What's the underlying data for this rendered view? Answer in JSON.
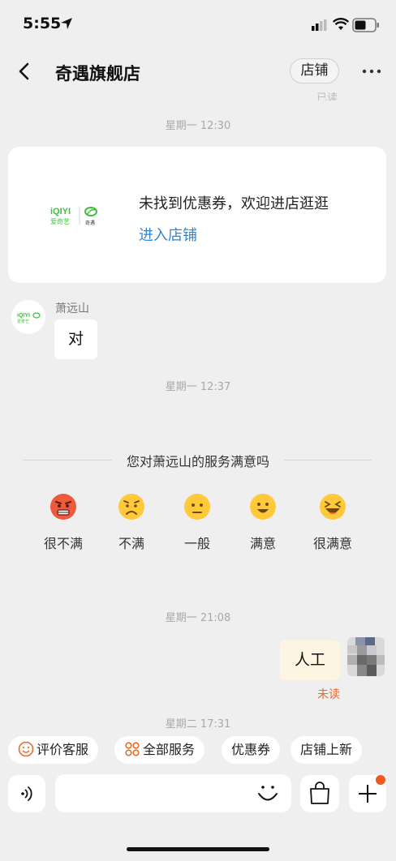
{
  "status": {
    "time": "5:55"
  },
  "header": {
    "title": "奇遇旗舰店",
    "shop_label": "店铺"
  },
  "read_hint": "已读",
  "timestamps": [
    "星期一 12:30",
    "星期一 12:37",
    "星期一 21:08",
    "星期二 17:31"
  ],
  "coupon_card": {
    "message": "未找到优惠券，欢迎进店逛逛",
    "link": "进入店铺",
    "logo_text": "iQIYI",
    "logo_sub": "爱奇艺",
    "logo_brand": "奇遇"
  },
  "incoming": {
    "sender": "萧远山",
    "text": "对",
    "avatar_text": "iQIYI"
  },
  "satisfaction": {
    "title": "您对萧远山的服务满意吗",
    "options": [
      {
        "label": "很不满",
        "color": "#f05a3c"
      },
      {
        "label": "不满",
        "color": "#ffc93a"
      },
      {
        "label": "一般",
        "color": "#ffc93a"
      },
      {
        "label": "满意",
        "color": "#ffc93a"
      },
      {
        "label": "很满意",
        "color": "#ffc93a"
      }
    ]
  },
  "outgoing": {
    "text": "人工",
    "status": "未读"
  },
  "quick_chips": [
    "评价客服",
    "全部服务",
    "优惠券",
    "店铺上新"
  ],
  "colors": {
    "accent_orange": "#e8692b",
    "link_blue": "#2f86d4",
    "bubble_out": "#fdf5e2"
  }
}
